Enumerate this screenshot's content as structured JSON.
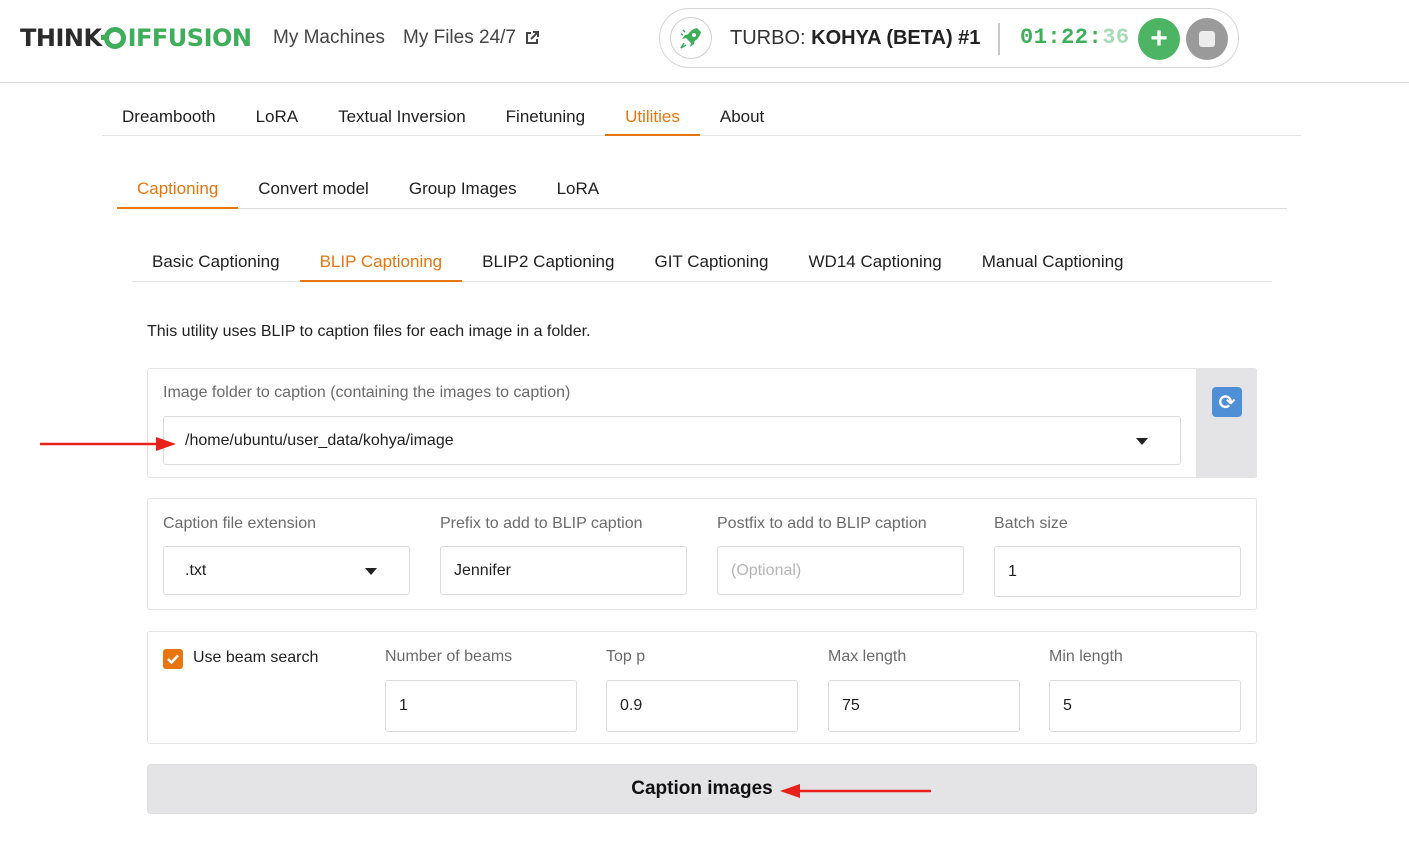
{
  "header": {
    "logo_left": "THINK",
    "logo_right": "IFFUSION",
    "nav": [
      {
        "label": "My Machines"
      },
      {
        "label": "My Files 24/7",
        "icon": "external-link-icon"
      }
    ],
    "machine": {
      "prefix": "TURBO:",
      "name": "KOHYA (BETA) #1",
      "timer_main": "01:22:",
      "timer_secs": "36",
      "add_label": "+",
      "icon": "rocket-icon",
      "accent": "#3fae5a"
    }
  },
  "tabs_main": [
    "Dreambooth",
    "LoRA",
    "Textual Inversion",
    "Finetuning",
    "Utilities",
    "About"
  ],
  "tabs_utilities": [
    "Captioning",
    "Convert model",
    "Group Images",
    "LoRA"
  ],
  "tabs_captioning": [
    "Basic Captioning",
    "BLIP Captioning",
    "BLIP2 Captioning",
    "GIT Captioning",
    "WD14 Captioning",
    "Manual Captioning"
  ],
  "active": {
    "main": "Utilities",
    "utilities": "Captioning",
    "captioning": "BLIP Captioning"
  },
  "description": "This utility uses BLIP to caption files for each image in a folder.",
  "folder": {
    "label": "Image folder to caption (containing the images to caption)",
    "value": "/home/ubuntu/user_data/kohya/image",
    "refresh_icon": "refresh-icon"
  },
  "options": {
    "ext_label": "Caption file extension",
    "ext_value": ".txt",
    "prefix_label": "Prefix to add to BLIP caption",
    "prefix_value": "Jennifer",
    "postfix_label": "Postfix to add to BLIP caption",
    "postfix_placeholder": "(Optional)",
    "batch_label": "Batch size",
    "batch_value": "1"
  },
  "beam": {
    "checkbox_label": "Use beam search",
    "checked": true,
    "beams_label": "Number of beams",
    "beams_value": "1",
    "top_p_label": "Top p",
    "top_p_value": "0.9",
    "max_label": "Max length",
    "max_value": "75",
    "min_label": "Min length",
    "min_value": "5"
  },
  "action": {
    "caption_button": "Caption images"
  },
  "colors": {
    "accent_orange": "#e8750e",
    "brand_green": "#3fae5a",
    "annotation_red": "#e8221b"
  }
}
